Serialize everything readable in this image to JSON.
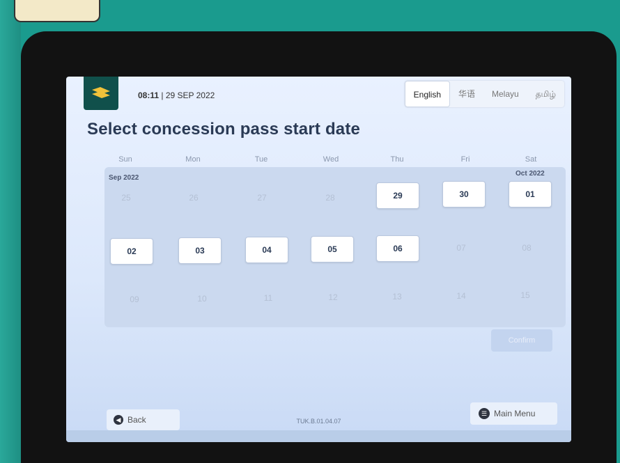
{
  "header": {
    "time": "08:11",
    "date": "| 29 SEP 2022"
  },
  "languages": [
    {
      "label": "English",
      "active": true
    },
    {
      "label": "华语",
      "active": false
    },
    {
      "label": "Melayu",
      "active": false
    },
    {
      "label": "தமிழ்",
      "active": false
    }
  ],
  "title": "Select concession pass start date",
  "weekdays": [
    "Sun",
    "Mon",
    "Tue",
    "Wed",
    "Thu",
    "Fri",
    "Sat"
  ],
  "months": {
    "sep": "Sep 2022",
    "oct": "Oct 2022"
  },
  "rows": [
    {
      "cells": [
        {
          "d": "25",
          "en": false
        },
        {
          "d": "26",
          "en": false
        },
        {
          "d": "27",
          "en": false
        },
        {
          "d": "28",
          "en": false
        },
        {
          "d": "29",
          "en": true
        },
        {
          "d": "30",
          "en": true
        },
        {
          "d": "01",
          "en": true
        }
      ]
    },
    {
      "cells": [
        {
          "d": "02",
          "en": true
        },
        {
          "d": "03",
          "en": true
        },
        {
          "d": "04",
          "en": true
        },
        {
          "d": "05",
          "en": true
        },
        {
          "d": "06",
          "en": true
        },
        {
          "d": "07",
          "en": false
        },
        {
          "d": "08",
          "en": false
        }
      ]
    },
    {
      "cells": [
        {
          "d": "09",
          "en": false
        },
        {
          "d": "10",
          "en": false
        },
        {
          "d": "11",
          "en": false
        },
        {
          "d": "12",
          "en": false
        },
        {
          "d": "13",
          "en": false
        },
        {
          "d": "14",
          "en": false
        },
        {
          "d": "15",
          "en": false
        }
      ]
    }
  ],
  "buttons": {
    "confirm": "Confirm",
    "back": "Back",
    "main_menu": "Main Menu"
  },
  "version": "TUK.B.01.04.07",
  "colors": {
    "brand": "#10504b",
    "kiosk": "#1a9b8e"
  }
}
